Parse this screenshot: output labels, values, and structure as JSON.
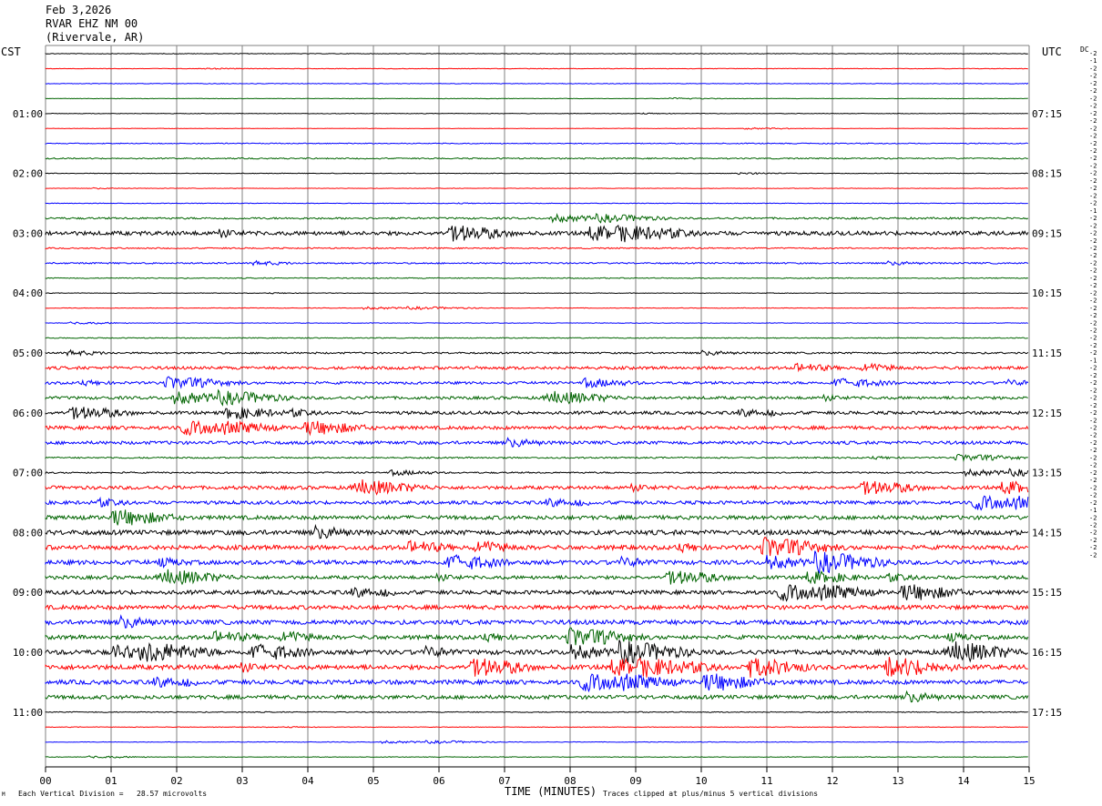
{
  "header": {
    "date": "Feb 3,2026",
    "station": "RVAR EHZ NM 00",
    "location": "(Rivervale, AR)"
  },
  "left_tz": "CST",
  "right_tz": "UTC",
  "dc_label": "DC",
  "footer": {
    "scale_note": "Each Vertical Division =   28.57 microvolts",
    "clip_note": "Traces clipped at plus/minus 5 vertical divisions",
    "corner_mark": "M"
  },
  "chart_data": {
    "type": "line",
    "xlabel": "TIME (MINUTES)",
    "x_ticks": [
      "00",
      "01",
      "02",
      "03",
      "04",
      "05",
      "06",
      "07",
      "08",
      "09",
      "10",
      "11",
      "12",
      "13",
      "14",
      "15"
    ],
    "xlim": [
      0,
      15
    ],
    "trace_colors": [
      "#000000",
      "#ff0000",
      "#0000ff",
      "#006400"
    ],
    "left_hour_labels": [
      "01:00",
      "02:00",
      "03:00",
      "04:00",
      "05:00",
      "06:00",
      "07:00",
      "08:00",
      "09:00",
      "10:00",
      "11:00"
    ],
    "right_hour_labels": [
      "07:15",
      "08:15",
      "09:15",
      "10:15",
      "11:15",
      "12:15",
      "13:15",
      "14:15",
      "15:15",
      "16:15",
      "17:15"
    ],
    "dc_offsets": [
      "-2",
      "-1",
      "-2",
      "-2",
      "-2",
      "-2",
      "-2",
      "-2",
      "-2",
      "-2",
      "-2",
      "-2",
      "-2",
      "-2",
      "-2",
      "-2",
      "-2",
      "-2",
      "-2",
      "-2",
      "-2",
      "-1",
      "-2",
      "-2",
      "-2",
      "-2",
      "-2",
      "-2",
      "-2",
      "-2",
      "-2",
      "-2",
      "-2",
      "-2",
      "-2",
      "-2",
      "-2",
      "-2",
      "-2",
      "-2",
      "-2",
      "-1",
      "-2",
      "-2",
      "-2",
      "-2",
      "-2",
      "-2",
      "-2",
      "-2",
      "-2",
      "-2",
      "-2",
      "-2",
      "-2",
      "-2",
      "-2",
      "-2",
      "-2",
      "-2",
      "-2",
      "-1",
      "-2",
      "-2",
      "-2",
      "-2",
      "-2",
      "-2"
    ],
    "trace_activity": [
      0.2,
      0.15,
      0.2,
      0.15,
      0.2,
      0.15,
      0.3,
      0.4,
      0.2,
      0.15,
      0.2,
      0.6,
      1.4,
      0.4,
      0.5,
      0.3,
      0.2,
      0.2,
      0.2,
      0.3,
      0.6,
      1.0,
      0.9,
      1.0,
      1.1,
      1.2,
      1.1,
      0.5,
      0.5,
      1.2,
      1.2,
      1.4,
      1.6,
      1.5,
      1.5,
      1.2,
      1.4,
      1.4,
      1.5,
      1.4,
      1.6,
      1.6,
      1.5,
      1.3,
      0.3,
      0.2,
      0.2,
      0.2
    ]
  }
}
